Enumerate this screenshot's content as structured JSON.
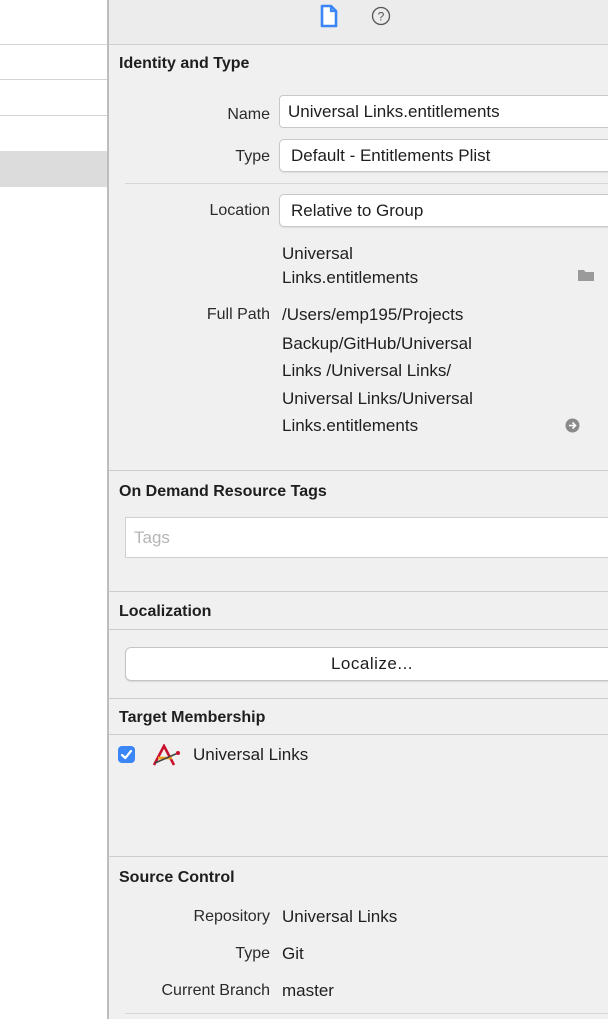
{
  "colors": {
    "accent": "#3b86f7",
    "panel_bg": "#f0f0f0"
  },
  "header": {
    "icons": [
      "file-icon",
      "help-icon"
    ],
    "help_glyph": "?"
  },
  "identity": {
    "title": "Identity and Type",
    "name_label": "Name",
    "name_value": "Universal Links.entitlements",
    "type_label": "Type",
    "type_value": "Default - Entitlements Plist",
    "location_label": "Location",
    "location_value": "Relative to Group",
    "location_file_lines": [
      "Universal",
      "Links.entitlements"
    ],
    "full_path_label": "Full Path",
    "full_path_lines": [
      "/Users/emp195/Projects",
      "Backup/GitHub/Universal",
      "Links /Universal Links/",
      "Universal Links/Universal",
      "Links.entitlements"
    ]
  },
  "on_demand": {
    "title": "On Demand Resource Tags",
    "tags_placeholder": "Tags"
  },
  "localization": {
    "title": "Localization",
    "button_label": "Localize..."
  },
  "target_membership": {
    "title": "Target Membership",
    "targets": [
      {
        "name": "Universal Links",
        "checked": true,
        "icon": "app-target-icon"
      }
    ]
  },
  "source_control": {
    "title": "Source Control",
    "repository_label": "Repository",
    "repository_value": "Universal Links",
    "type_label": "Type",
    "type_value": "Git",
    "branch_label": "Current Branch",
    "branch_value": "master"
  }
}
